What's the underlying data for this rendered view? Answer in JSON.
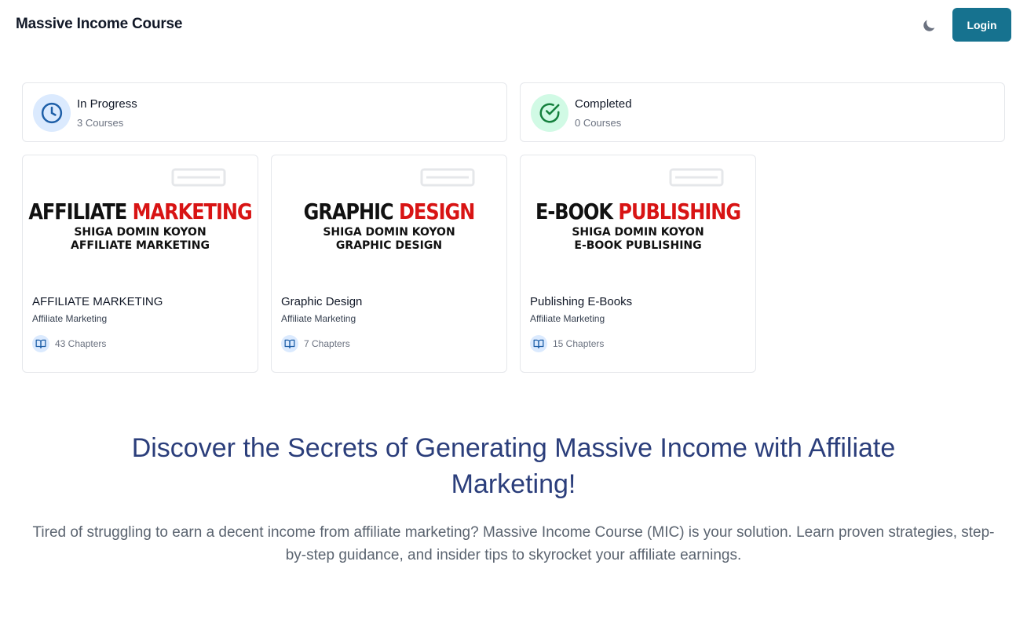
{
  "header": {
    "brand": "Massive Income Course",
    "theme_icon": "moon-icon",
    "login_label": "Login"
  },
  "stats": [
    {
      "title": "In Progress",
      "subtitle": "3 Courses",
      "icon": "clock-icon",
      "color": "#1e5fa8"
    },
    {
      "title": "Completed",
      "subtitle": "0 Courses",
      "icon": "check-circle-icon",
      "color": "#15803d"
    }
  ],
  "courses": [
    {
      "thumb_black": "AFFILIATE ",
      "thumb_red": "MARKETING",
      "thumb_line2": "SHIGA DOMIN KOYON",
      "thumb_line3": "AFFILIATE MARKETING",
      "name": "AFFILIATE MARKETING",
      "category": "Affiliate Marketing",
      "chapters": "43 Chapters"
    },
    {
      "thumb_black": "GRAPHIC ",
      "thumb_red": "DESIGN",
      "thumb_line2": "SHIGA DOMIN KOYON",
      "thumb_line3": "GRAPHIC DESIGN",
      "name": "Graphic Design",
      "category": "Affiliate Marketing",
      "chapters": "7 Chapters"
    },
    {
      "thumb_black": "E-BOOK ",
      "thumb_red": "PUBLISHING",
      "thumb_line2": "SHIGA DOMIN KOYON",
      "thumb_line3": "E-BOOK PUBLISHING",
      "name": "Publishing E-Books",
      "category": "Affiliate Marketing",
      "chapters": "15 Chapters"
    }
  ],
  "hero": {
    "title": "Discover the Secrets of Generating Massive Income with Affiliate Marketing!",
    "text": "Tired of struggling to earn a decent income from affiliate marketing? Massive Income Course (MIC) is your solution. Learn proven strategies, step-by-step guidance, and insider tips to skyrocket your affiliate earnings."
  },
  "colors": {
    "accent": "#16728f",
    "hero_title": "#2b3e7b",
    "thumb_red": "#d81414"
  }
}
